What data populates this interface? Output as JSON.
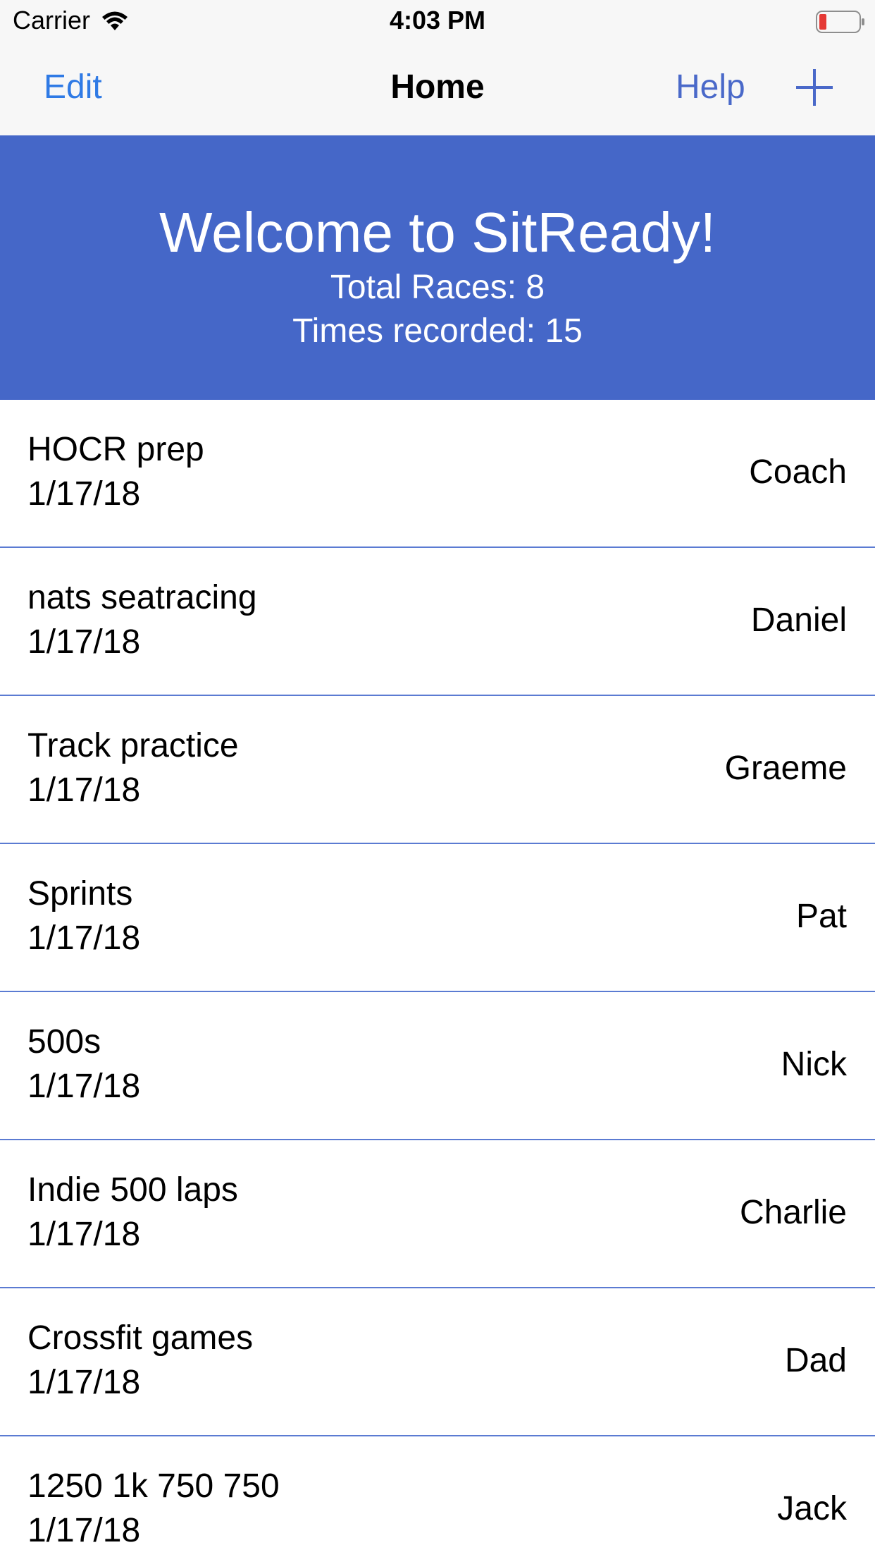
{
  "status_bar": {
    "carrier": "Carrier",
    "time": "4:03 PM",
    "wifi_icon": "wifi-icon",
    "battery_icon": "battery-low-icon",
    "battery_color": "#e53935"
  },
  "nav": {
    "edit_label": "Edit",
    "title": "Home",
    "help_label": "Help",
    "add_icon": "plus-icon",
    "accent_color": "#2f7ae5"
  },
  "banner": {
    "title": "Welcome to SitReady!",
    "total_races": "Total Races: 8",
    "times_recorded": "Times recorded: 15",
    "background_color": "#4567c8"
  },
  "races": [
    {
      "name": "HOCR prep",
      "date": "1/17/18",
      "owner": "Coach"
    },
    {
      "name": "nats seatracing",
      "date": "1/17/18",
      "owner": "Daniel"
    },
    {
      "name": "Track practice",
      "date": "1/17/18",
      "owner": "Graeme"
    },
    {
      "name": "Sprints",
      "date": "1/17/18",
      "owner": "Pat"
    },
    {
      "name": "500s",
      "date": "1/17/18",
      "owner": "Nick"
    },
    {
      "name": "Indie 500 laps",
      "date": "1/17/18",
      "owner": "Charlie"
    },
    {
      "name": "Crossfit games",
      "date": "1/17/18",
      "owner": "Dad"
    },
    {
      "name": "1250 1k 750 750",
      "date": "1/17/18",
      "owner": "Jack"
    }
  ]
}
